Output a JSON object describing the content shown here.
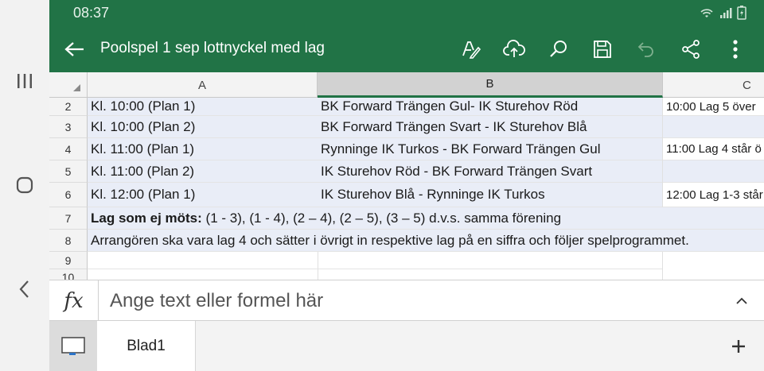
{
  "status_bar": {
    "time": "08:37"
  },
  "app_bar": {
    "title": "Poolspel 1 sep lottnyckel med lag"
  },
  "columns": [
    "A",
    "B",
    "C"
  ],
  "rows": [
    {
      "num": "2",
      "a": "Kl. 10:00 (Plan 1)",
      "b": "BK Forward Trängen Gul- IK Sturehov Röd",
      "c": "10:00 Lag 5 över"
    },
    {
      "num": "3",
      "a": "Kl. 10:00 (Plan 2)",
      "b": "BK Forward Trängen Svart - IK Sturehov Blå",
      "c": ""
    },
    {
      "num": "4",
      "a": "Kl. 11:00 (Plan 1)",
      "b": "Rynninge IK Turkos - BK Forward Trängen Gul",
      "c": "11:00 Lag 4 står ö"
    },
    {
      "num": "5",
      "a": "Kl. 11:00 (Plan 2)",
      "b": "IK Sturehov Röd - BK Forward Trängen Svart",
      "c": ""
    },
    {
      "num": "6",
      "a": "Kl. 12:00 (Plan 1)",
      "b": "IK Sturehov Blå - Rynninge IK Turkos",
      "c": "12:00 Lag 1-3 står"
    }
  ],
  "row7": {
    "num": "7",
    "bold": "Lag som ej möts:",
    "rest": " (1 - 3), (1 - 4), (2 – 4), (2 – 5), (3 – 5) d.v.s. samma förening"
  },
  "row8": {
    "num": "8",
    "text": "Arrangören ska vara lag 4 och sätter i övrigt in respektive lag på en siffra och följer spelprogrammet."
  },
  "row9": {
    "num": "9"
  },
  "row10": {
    "num": "10"
  },
  "formula_bar": {
    "fx": "fx",
    "placeholder": "Ange text eller formel här"
  },
  "tabs": [
    {
      "label": "Blad1"
    }
  ],
  "colors": {
    "brand": "#217346",
    "row_highlight": "#e9edf7"
  }
}
